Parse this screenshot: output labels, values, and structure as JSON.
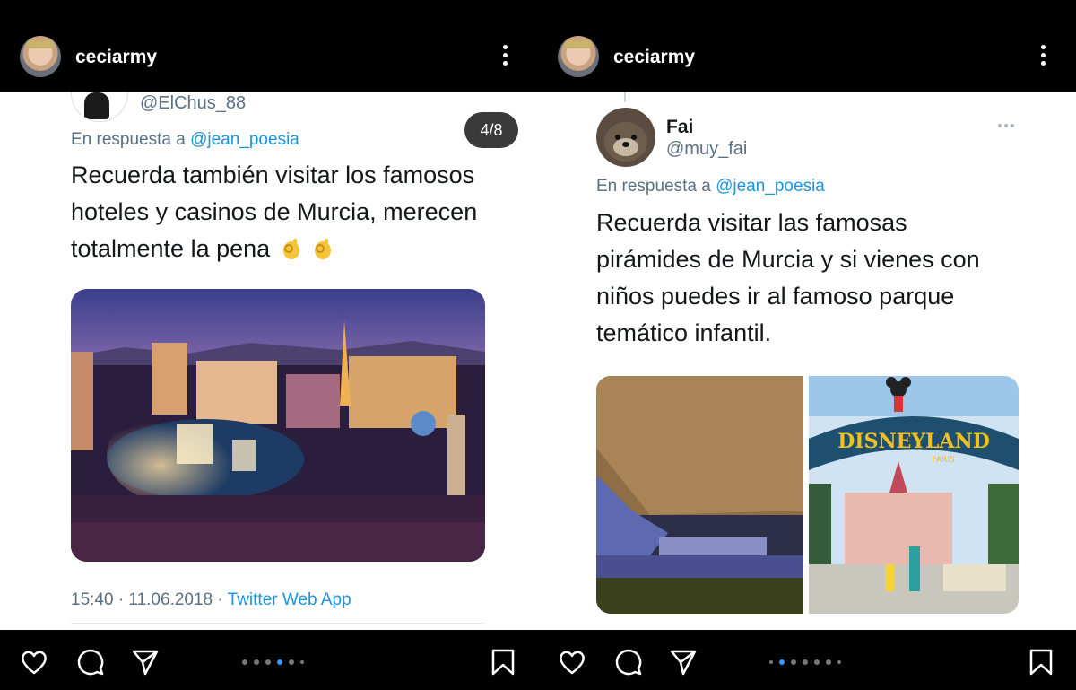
{
  "left": {
    "username": "ceciarmy",
    "tweet": {
      "handle": "@ElChus_88",
      "reply_prefix": "En respuesta a",
      "reply_to": "@jean_poesia",
      "text_lines": [
        "Recuerda también visitar los famosos",
        "hoteles y casinos de Murcia, merecen",
        "totalmente la pena"
      ],
      "emoji": "👌 👌",
      "counter": "4/8",
      "time": "15:40 · 11.06.2018 · ",
      "source": "Twitter Web App",
      "image_alt": "Las Vegas Strip at dusk with Bellagio fountains"
    },
    "pagination": {
      "count": 6,
      "active": 3
    }
  },
  "right": {
    "username": "ceciarmy",
    "tweet": {
      "name": "Fai",
      "handle": "@muy_fai",
      "reply_prefix": "En respuesta a",
      "reply_to": "@jean_poesia",
      "text_lines": [
        "Recuerda visitar las famosas",
        "pirámides de Murcia y si vienes con",
        "niños puedes ir al famoso parque",
        "temático infantil."
      ],
      "image_alt_1": "Pyramid and sphinx at night",
      "image_alt_2": "Disneyland Paris entrance",
      "disney_sign": "DISNEYLAND",
      "disney_sub": "PARIS"
    },
    "pagination": {
      "count": 7,
      "active": 1
    }
  },
  "icons": [
    "heart-icon",
    "comment-icon",
    "share-icon",
    "bookmark-icon",
    "more-icon"
  ],
  "colors": {
    "link": "#1b95e0",
    "muted": "#5b7083",
    "active_dot": "#3897f0"
  }
}
